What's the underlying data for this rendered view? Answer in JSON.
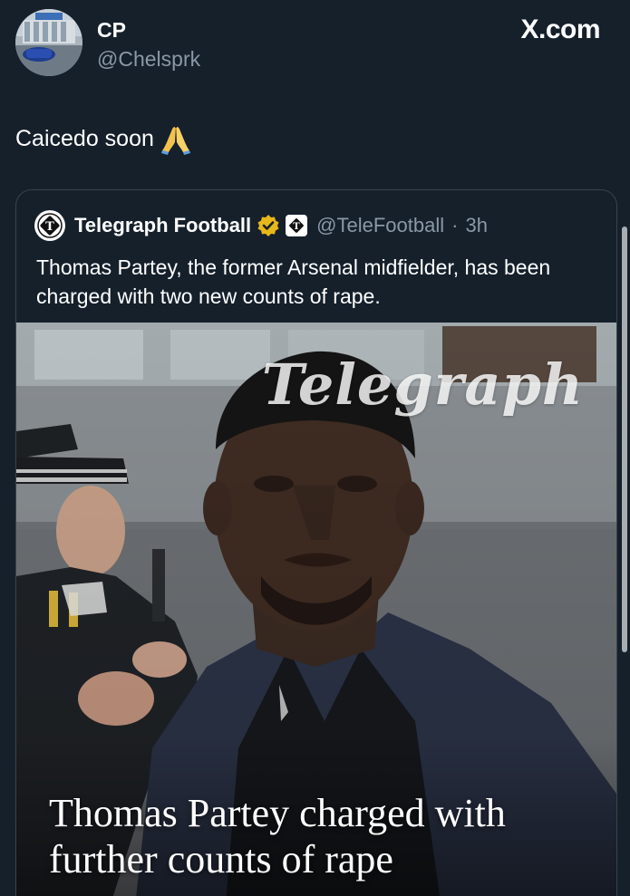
{
  "author": {
    "name": "CP",
    "handle": "@Chelsprk"
  },
  "brand": "X.com",
  "tweet": {
    "text": "Caicedo soon",
    "emoji": "🙏"
  },
  "quote": {
    "name": "Telegraph Football",
    "handle": "@TeleFootball",
    "separator": "·",
    "time": "3h",
    "text": "Thomas Partey, the former Arsenal midfielder, has been charged with two new counts of rape.",
    "image": {
      "watermark": "Telegraph",
      "headline": "Thomas Partey charged with further counts of rape"
    }
  },
  "colors": {
    "background": "#15202b",
    "secondary_text": "#8b98a5",
    "verified_gold": "#e8b71a",
    "border": "#38444d"
  }
}
